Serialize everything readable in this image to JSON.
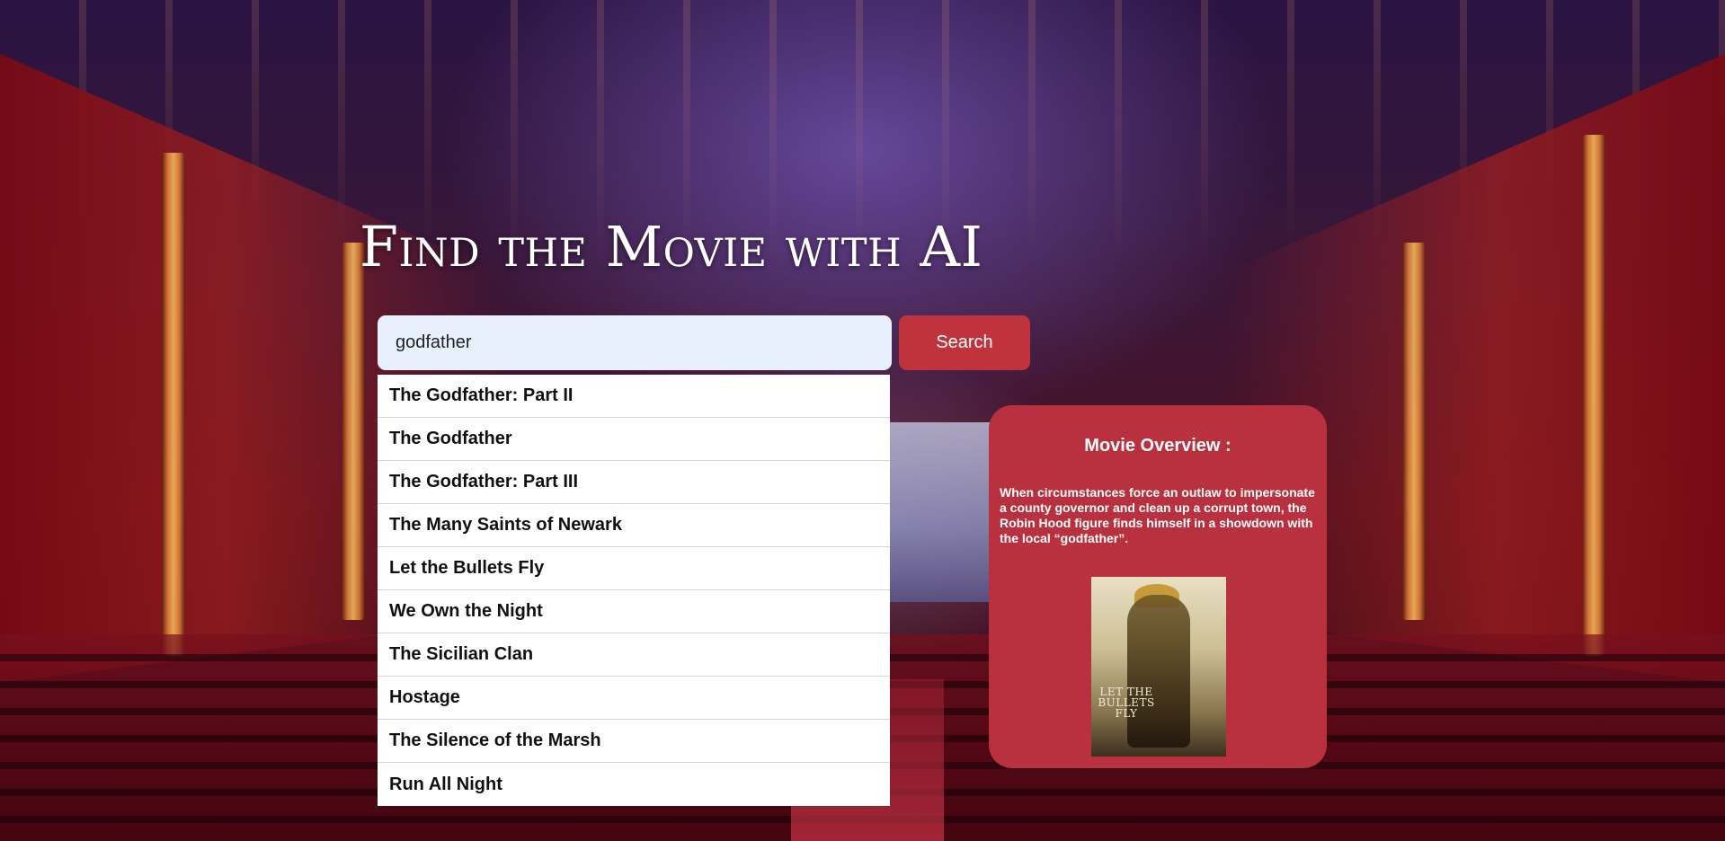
{
  "header": {
    "title": "Find the Movie with AI"
  },
  "search": {
    "value": "godfather",
    "placeholder": "",
    "button_label": "Search"
  },
  "suggestions": [
    "The Godfather: Part II",
    "The Godfather",
    "The Godfather: Part III",
    "The Many Saints of Newark",
    "Let the Bullets Fly",
    "We Own the Night",
    "The Sicilian Clan",
    "Hostage",
    "The Silence of the Marsh",
    "Run All Night"
  ],
  "overview": {
    "title": "Movie Overview :",
    "text": "When circumstances force an outlaw to impersonate a county governor and clean up a corrupt town, the Robin Hood figure finds himself in a showdown with the local “godfather”.",
    "poster_text": "LET THE BULLETS FLY"
  },
  "colors": {
    "accent": "#c0333d",
    "card": "#b9313f",
    "input_bg": "#e8f0fe"
  }
}
